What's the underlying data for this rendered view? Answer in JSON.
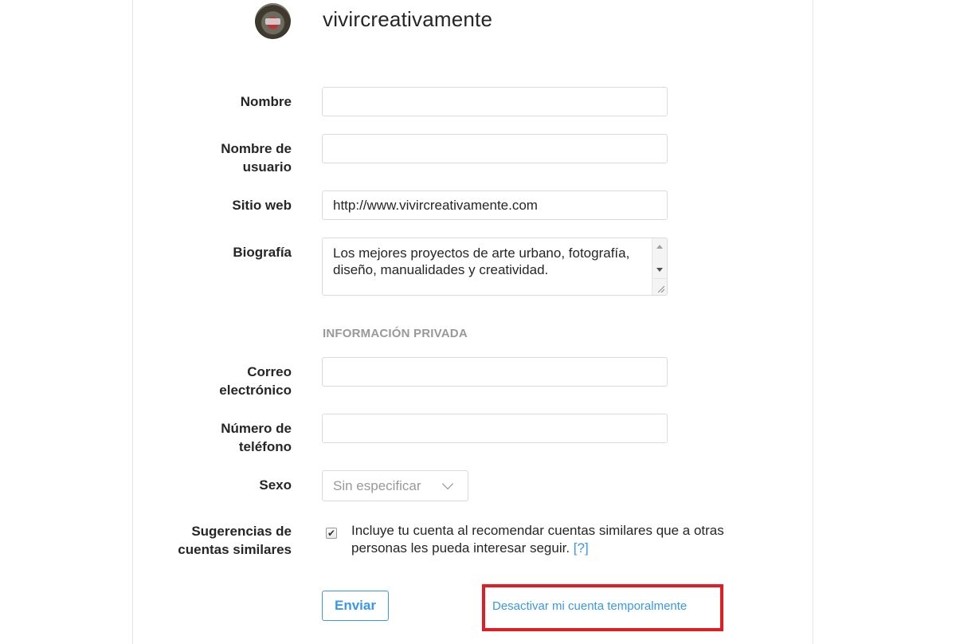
{
  "profile": {
    "username": "vivircreativamente"
  },
  "form": {
    "name": {
      "label": "Nombre",
      "value": ""
    },
    "username": {
      "label_line1": "Nombre de",
      "label_line2": "usuario",
      "value": ""
    },
    "website": {
      "label": "Sitio web",
      "value": "http://www.vivircreativamente.com"
    },
    "bio": {
      "label": "Biografía",
      "value": "Los mejores proyectos de arte urbano, fotografía, diseño, manualidades y creatividad."
    },
    "private_section": "INFORMACIÓN PRIVADA",
    "email": {
      "label_line1": "Correo",
      "label_line2": "electrónico",
      "value": ""
    },
    "phone": {
      "label_line1": "Número de",
      "label_line2": "teléfono",
      "value": ""
    },
    "gender": {
      "label": "Sexo",
      "selected": "Sin especificar"
    },
    "suggestions": {
      "label_line1": "Sugerencias de",
      "label_line2": "cuentas similares",
      "checked": true,
      "text": "Incluye tu cuenta al recomendar cuentas similares que a otras personas les pueda interesar seguir.",
      "help_link": "[?]"
    },
    "submit_label": "Enviar",
    "deactivate_link": "Desactivar mi cuenta temporalmente"
  },
  "colors": {
    "accent": "#3897f0",
    "highlight_box": "#e21c23",
    "border": "#dbdbdb",
    "muted": "#999999"
  }
}
